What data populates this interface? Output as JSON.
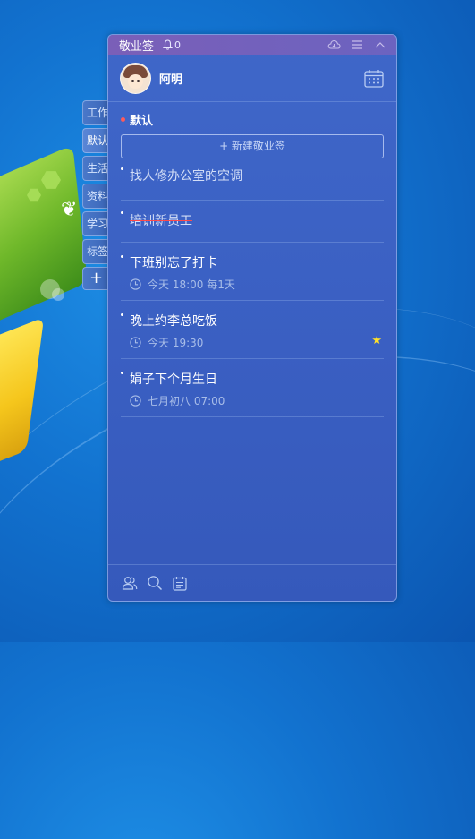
{
  "app": {
    "title": "敬业签",
    "notification_count": "0"
  },
  "user": {
    "name": "阿明"
  },
  "side_tabs": [
    {
      "label": "工作"
    },
    {
      "label": "默认"
    },
    {
      "label": "生活"
    },
    {
      "label": "资料"
    },
    {
      "label": "学习"
    },
    {
      "label": "标签"
    }
  ],
  "side_add_label": "+",
  "category": {
    "name": "默认",
    "dot_color": "#ff5a5a"
  },
  "new_note_button": "+ 新建敬业签",
  "notes": [
    {
      "title": "找人修办公室的空调",
      "done": true
    },
    {
      "title": "培训新员工",
      "done": true
    },
    {
      "title": "下班别忘了打卡",
      "time": "今天 18:00 每1天"
    },
    {
      "title": "晚上约李总吃饭",
      "time": "今天 19:30",
      "starred": true
    },
    {
      "title": "娟子下个月生日",
      "time": "七月初八 07:00"
    }
  ],
  "colors": {
    "titlebar": "#7a5fb8",
    "panel": "#3f67c9",
    "strike": "#ff4a4a",
    "star": "#ffe12a"
  },
  "icons": {
    "titlebar": [
      "bell-icon",
      "cloud-icon",
      "menu-icon",
      "collapse-icon"
    ],
    "bottom": [
      "contacts-icon",
      "search-icon",
      "notes-icon"
    ]
  }
}
